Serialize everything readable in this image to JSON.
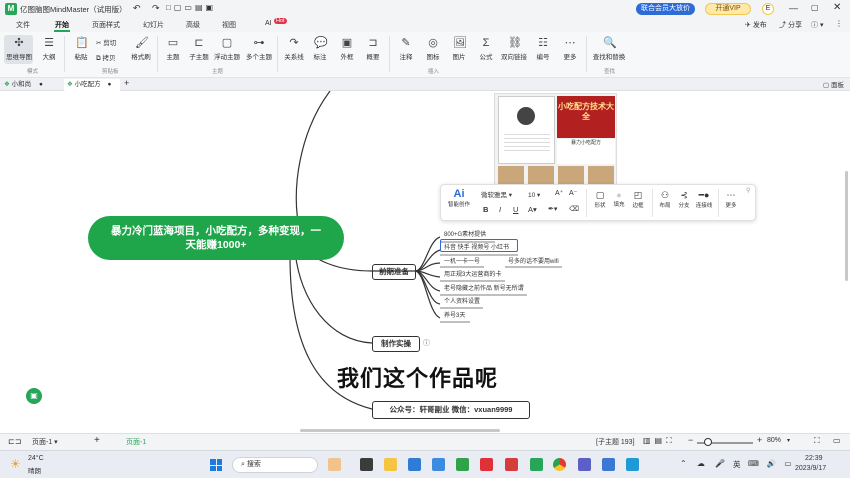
{
  "app": {
    "title": "亿图脑图MindMaster（试用版）",
    "vip_button": "开通VIP",
    "member_badge": "联合会员大放价",
    "avatar_letter": "E",
    "publish": "发布",
    "share": "分享",
    "help": "?"
  },
  "menu": [
    "文件",
    "开始",
    "页面样式",
    "幻灯片",
    "高级",
    "视图",
    "AI"
  ],
  "menu_active": "开始",
  "ai_badge": "Hot",
  "ribbon": {
    "buttons": [
      {
        "label": "思维导图",
        "icon": "✣"
      },
      {
        "label": "大纲",
        "icon": "☰"
      },
      {
        "label": "粘贴",
        "icon": "📋"
      },
      {
        "label": "格式刷",
        "icon": "🖌"
      },
      {
        "label": "主题",
        "icon": "▭"
      },
      {
        "label": "子主题",
        "icon": "⊏"
      },
      {
        "label": "浮动主题",
        "icon": "▢"
      },
      {
        "label": "多个主题",
        "icon": "⊶"
      },
      {
        "label": "关系线",
        "icon": "↷"
      },
      {
        "label": "标注",
        "icon": "💬"
      },
      {
        "label": "外框",
        "icon": "▣"
      },
      {
        "label": "概要",
        "icon": "⊐"
      },
      {
        "label": "注释",
        "icon": "✎"
      },
      {
        "label": "图标",
        "icon": "◎"
      },
      {
        "label": "图片",
        "icon": "🖼"
      },
      {
        "label": "公式",
        "icon": "Σ"
      },
      {
        "label": "双向链接",
        "icon": "⛓"
      },
      {
        "label": "编号",
        "icon": "☷"
      },
      {
        "label": "更多",
        "icon": "⋯"
      },
      {
        "label": "查找和替换",
        "icon": "🔍"
      }
    ],
    "cut": "剪切",
    "copy": "拷贝",
    "groups": [
      "模式",
      "剪贴板",
      "主题",
      "插入",
      "查找"
    ]
  },
  "doc_tabs": [
    {
      "label": "小和尚"
    },
    {
      "label": "小吃配方"
    }
  ],
  "panel_label": "面板",
  "mindmap": {
    "root": "暴力冷门蓝海项目，小吃配方，多种变现，一天能赚1000+",
    "branch_prep": "前期准备",
    "prep_items": [
      "800+G素材提供",
      "抖音 快手 视频号 小红书",
      "一机一卡一号",
      "号多的话不要用wifi",
      "用正规3大运营商的卡",
      "老号隐藏之前作品 新号无所谓",
      "个人资料设置",
      "养号3天"
    ],
    "branch_make": "制作实操",
    "contact": "公众号：轩哥副业    微信：vxuan9999",
    "subtitle": "我们这个作品呢",
    "image_title": "小吃配方技术大全",
    "image_sub": "暴力小吃配方"
  },
  "float_toolbar": {
    "ai": "智能创作",
    "font": "微软雅黑",
    "size": "10",
    "items": [
      "形状",
      "填充",
      "边框",
      "布局",
      "分支",
      "连接线",
      "更多"
    ]
  },
  "status": {
    "page_dropdown": "页面-1",
    "page_tab": "页面-1",
    "topic_count": "[子主题 193]",
    "zoom": "80%"
  },
  "taskbar": {
    "weather_temp": "24°C",
    "weather_text": "晴朗",
    "search": "搜索",
    "time": "22:39",
    "date": "2023/9/17",
    "lang": "英"
  },
  "colors": {
    "brand": "#27a559",
    "root": "#1fa64a",
    "accent": "#2e6bd6"
  }
}
